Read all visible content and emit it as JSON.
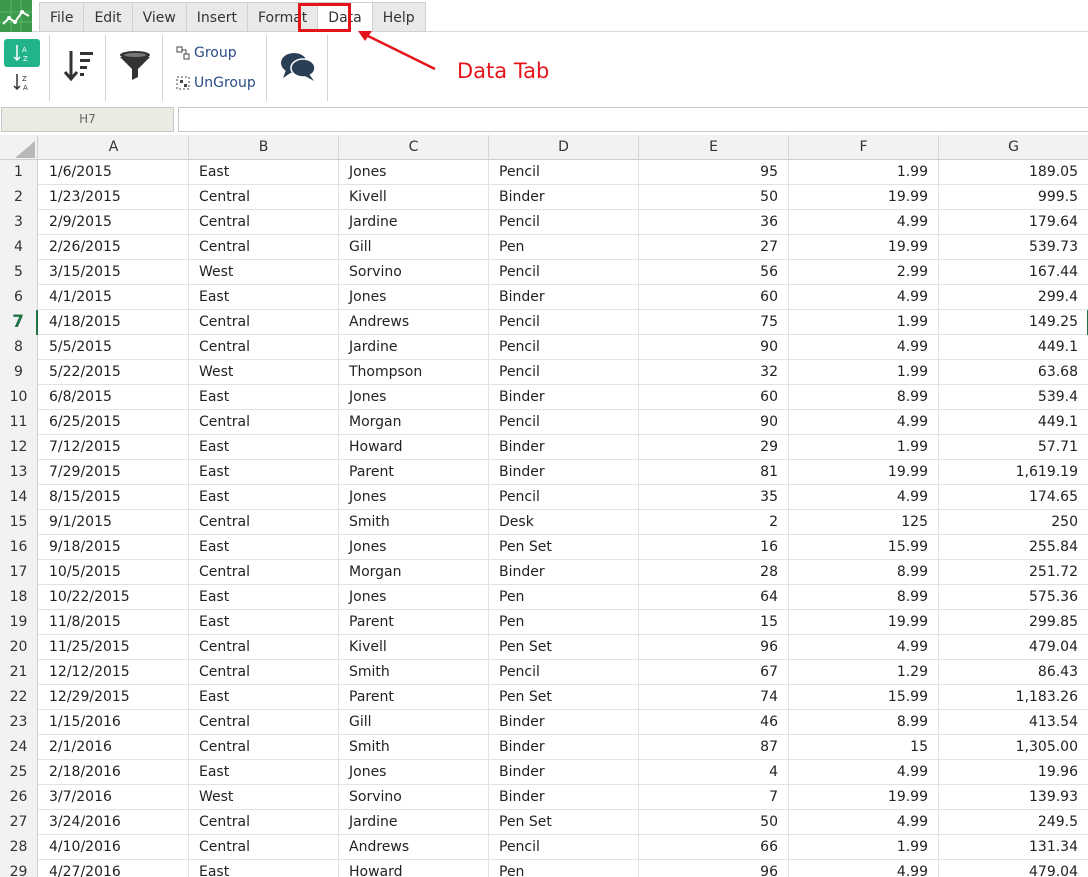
{
  "menu": {
    "tabs": [
      {
        "label": "File"
      },
      {
        "label": "Edit"
      },
      {
        "label": "View"
      },
      {
        "label": "Insert"
      },
      {
        "label": "Format"
      },
      {
        "label": "Data"
      },
      {
        "label": "Help"
      }
    ],
    "active_tab": "Data"
  },
  "toolbar": {
    "group_label": "Group",
    "ungroup_label": "UnGroup",
    "icons": [
      "sort-ascending-icon",
      "sort-descending-icon",
      "sort-icon",
      "filter-icon",
      "group-icon",
      "ungroup-icon",
      "comments-icon"
    ]
  },
  "annotation": {
    "label": "Data Tab",
    "color": "#e4141a"
  },
  "formula_bar": {
    "cell_reference": "H7",
    "value": ""
  },
  "grid": {
    "selected_row": 7,
    "columns": [
      "A",
      "B",
      "C",
      "D",
      "E",
      "F",
      "G"
    ],
    "rows": [
      {
        "n": "1",
        "a": "1/6/2015",
        "b": "East",
        "c": "Jones",
        "d": "Pencil",
        "e": "95",
        "f": "1.99",
        "g": "189.05"
      },
      {
        "n": "2",
        "a": "1/23/2015",
        "b": "Central",
        "c": "Kivell",
        "d": "Binder",
        "e": "50",
        "f": "19.99",
        "g": "999.5"
      },
      {
        "n": "3",
        "a": "2/9/2015",
        "b": "Central",
        "c": "Jardine",
        "d": "Pencil",
        "e": "36",
        "f": "4.99",
        "g": "179.64"
      },
      {
        "n": "4",
        "a": "2/26/2015",
        "b": "Central",
        "c": "Gill",
        "d": "Pen",
        "e": "27",
        "f": "19.99",
        "g": "539.73"
      },
      {
        "n": "5",
        "a": "3/15/2015",
        "b": "West",
        "c": "Sorvino",
        "d": "Pencil",
        "e": "56",
        "f": "2.99",
        "g": "167.44"
      },
      {
        "n": "6",
        "a": "4/1/2015",
        "b": "East",
        "c": "Jones",
        "d": "Binder",
        "e": "60",
        "f": "4.99",
        "g": "299.4"
      },
      {
        "n": "7",
        "a": "4/18/2015",
        "b": "Central",
        "c": "Andrews",
        "d": "Pencil",
        "e": "75",
        "f": "1.99",
        "g": "149.25"
      },
      {
        "n": "8",
        "a": "5/5/2015",
        "b": "Central",
        "c": "Jardine",
        "d": "Pencil",
        "e": "90",
        "f": "4.99",
        "g": "449.1"
      },
      {
        "n": "9",
        "a": "5/22/2015",
        "b": "West",
        "c": "Thompson",
        "d": "Pencil",
        "e": "32",
        "f": "1.99",
        "g": "63.68"
      },
      {
        "n": "10",
        "a": "6/8/2015",
        "b": "East",
        "c": "Jones",
        "d": "Binder",
        "e": "60",
        "f": "8.99",
        "g": "539.4"
      },
      {
        "n": "11",
        "a": "6/25/2015",
        "b": "Central",
        "c": "Morgan",
        "d": "Pencil",
        "e": "90",
        "f": "4.99",
        "g": "449.1"
      },
      {
        "n": "12",
        "a": "7/12/2015",
        "b": "East",
        "c": "Howard",
        "d": "Binder",
        "e": "29",
        "f": "1.99",
        "g": "57.71"
      },
      {
        "n": "13",
        "a": "7/29/2015",
        "b": "East",
        "c": "Parent",
        "d": "Binder",
        "e": "81",
        "f": "19.99",
        "g": "1,619.19"
      },
      {
        "n": "14",
        "a": "8/15/2015",
        "b": "East",
        "c": "Jones",
        "d": "Pencil",
        "e": "35",
        "f": "4.99",
        "g": "174.65"
      },
      {
        "n": "15",
        "a": "9/1/2015",
        "b": "Central",
        "c": "Smith",
        "d": "Desk",
        "e": "2",
        "f": "125",
        "g": "250"
      },
      {
        "n": "16",
        "a": "9/18/2015",
        "b": "East",
        "c": "Jones",
        "d": "Pen Set",
        "e": "16",
        "f": "15.99",
        "g": "255.84"
      },
      {
        "n": "17",
        "a": "10/5/2015",
        "b": "Central",
        "c": "Morgan",
        "d": "Binder",
        "e": "28",
        "f": "8.99",
        "g": "251.72"
      },
      {
        "n": "18",
        "a": "10/22/2015",
        "b": "East",
        "c": "Jones",
        "d": "Pen",
        "e": "64",
        "f": "8.99",
        "g": "575.36"
      },
      {
        "n": "19",
        "a": "11/8/2015",
        "b": "East",
        "c": "Parent",
        "d": "Pen",
        "e": "15",
        "f": "19.99",
        "g": "299.85"
      },
      {
        "n": "20",
        "a": "11/25/2015",
        "b": "Central",
        "c": "Kivell",
        "d": "Pen Set",
        "e": "96",
        "f": "4.99",
        "g": "479.04"
      },
      {
        "n": "21",
        "a": "12/12/2015",
        "b": "Central",
        "c": "Smith",
        "d": "Pencil",
        "e": "67",
        "f": "1.29",
        "g": "86.43"
      },
      {
        "n": "22",
        "a": "12/29/2015",
        "b": "East",
        "c": "Parent",
        "d": "Pen Set",
        "e": "74",
        "f": "15.99",
        "g": "1,183.26"
      },
      {
        "n": "23",
        "a": "1/15/2016",
        "b": "Central",
        "c": "Gill",
        "d": "Binder",
        "e": "46",
        "f": "8.99",
        "g": "413.54"
      },
      {
        "n": "24",
        "a": "2/1/2016",
        "b": "Central",
        "c": "Smith",
        "d": "Binder",
        "e": "87",
        "f": "15",
        "g": "1,305.00"
      },
      {
        "n": "25",
        "a": "2/18/2016",
        "b": "East",
        "c": "Jones",
        "d": "Binder",
        "e": "4",
        "f": "4.99",
        "g": "19.96"
      },
      {
        "n": "26",
        "a": "3/7/2016",
        "b": "West",
        "c": "Sorvino",
        "d": "Binder",
        "e": "7",
        "f": "19.99",
        "g": "139.93"
      },
      {
        "n": "27",
        "a": "3/24/2016",
        "b": "Central",
        "c": "Jardine",
        "d": "Pen Set",
        "e": "50",
        "f": "4.99",
        "g": "249.5"
      },
      {
        "n": "28",
        "a": "4/10/2016",
        "b": "Central",
        "c": "Andrews",
        "d": "Pencil",
        "e": "66",
        "f": "1.99",
        "g": "131.34"
      },
      {
        "n": "29",
        "a": "4/27/2016",
        "b": "East",
        "c": "Howard",
        "d": "Pen",
        "e": "96",
        "f": "4.99",
        "g": "479.04"
      }
    ]
  }
}
